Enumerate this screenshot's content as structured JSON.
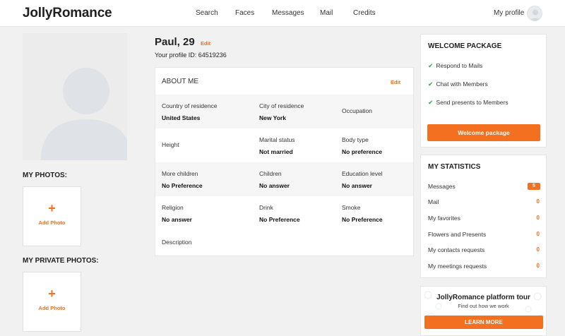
{
  "header": {
    "logo": "JollyRomance",
    "nav": [
      "Search",
      "Faces",
      "Messages",
      "Mail",
      "Credits"
    ],
    "my_profile": "My profile"
  },
  "sidebar": {
    "my_photos_label": "MY PHOTOS:",
    "my_private_photos_label": "MY PRIVATE PHOTOS:",
    "add_photo": "Add Photo",
    "plus": "+"
  },
  "profile": {
    "name": "Paul, 29",
    "edit": "Edit",
    "profile_id": "Your profile ID: 64519236"
  },
  "about": {
    "title": "ABOUT ME",
    "edit": "Edit",
    "rows": [
      [
        {
          "label": "Country of residence",
          "value": "United States"
        },
        {
          "label": "City of residence",
          "value": "New York"
        },
        {
          "label": "Occupation",
          "value": ""
        }
      ],
      [
        {
          "label": "Height",
          "value": ""
        },
        {
          "label": "Marital status",
          "value": "Not married"
        },
        {
          "label": "Body type",
          "value": "No preference"
        }
      ],
      [
        {
          "label": "More children",
          "value": "No Preference"
        },
        {
          "label": "Children",
          "value": "No answer"
        },
        {
          "label": "Education level",
          "value": "No answer"
        }
      ],
      [
        {
          "label": "Religion",
          "value": "No answer"
        },
        {
          "label": "Drink",
          "value": "No Preference"
        },
        {
          "label": "Smoke",
          "value": "No Preference"
        }
      ],
      [
        {
          "label": "Description",
          "value": ""
        }
      ]
    ]
  },
  "welcome": {
    "title": "WELCOME PACKAGE",
    "benefits": [
      "Respond to Mails",
      "Chat with Members",
      "Send presents to Members"
    ],
    "button": "Welcome package"
  },
  "statistics": {
    "title": "MY STATISTICS",
    "items": [
      {
        "label": "Messages",
        "value": "5"
      },
      {
        "label": "Mail",
        "value": "0"
      },
      {
        "label": "My favorites",
        "value": "0"
      },
      {
        "label": "Flowers and Presents",
        "value": "0"
      },
      {
        "label": "My contacts requests",
        "value": "0"
      },
      {
        "label": "My meetings requests",
        "value": "0"
      }
    ]
  },
  "tour": {
    "title": "JollyRomance platform tour",
    "subtitle": "Find out how we work",
    "button": "LEARN MORE"
  },
  "colors": {
    "accent": "#f37021",
    "check": "#2eaa4a",
    "background": "#f1f1f1"
  },
  "icons": {
    "check": "check-icon",
    "plus": "plus-icon",
    "avatar": "user-silhouette-icon"
  }
}
